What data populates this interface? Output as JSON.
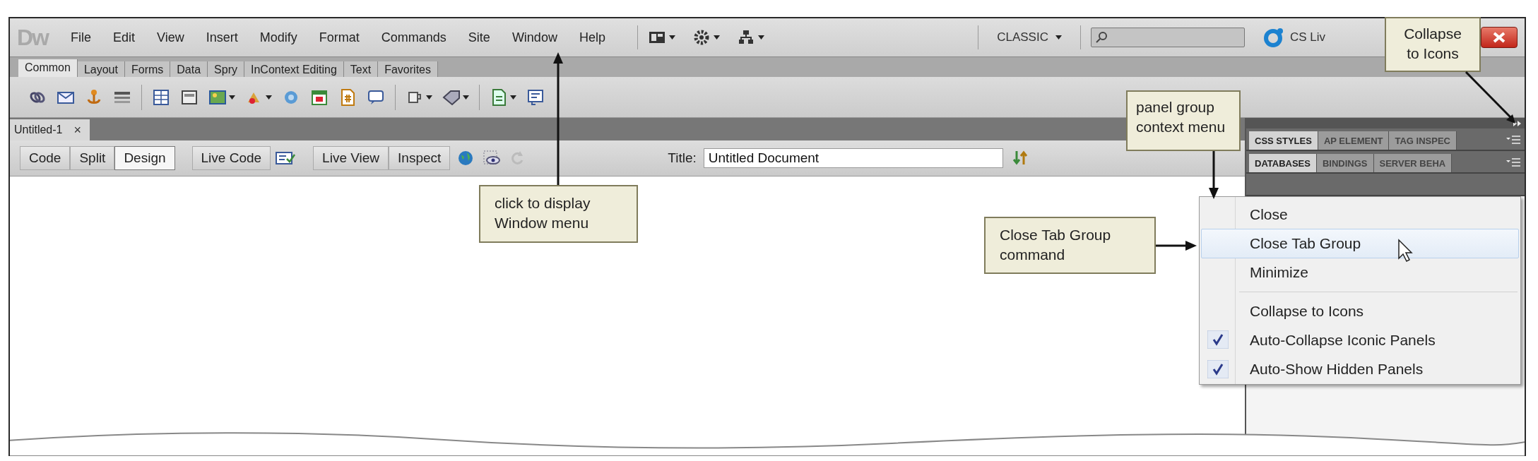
{
  "app": {
    "logo": "Dw",
    "menu": [
      "File",
      "Edit",
      "View",
      "Insert",
      "Modify",
      "Format",
      "Commands",
      "Site",
      "Window",
      "Help"
    ],
    "workspace": "CLASSIC",
    "cs_live": "CS Liv"
  },
  "insert_tabs": [
    {
      "label": "Common",
      "selected": true
    },
    {
      "label": "Layout",
      "selected": false
    },
    {
      "label": "Forms",
      "selected": false
    },
    {
      "label": "Data",
      "selected": false
    },
    {
      "label": "Spry",
      "selected": false
    },
    {
      "label": "InContext Editing",
      "selected": false
    },
    {
      "label": "Text",
      "selected": false
    },
    {
      "label": "Favorites",
      "selected": false
    }
  ],
  "document_tab": {
    "label": "Untitled-1",
    "close": "×"
  },
  "view_buttons": [
    {
      "label": "Code",
      "selected": false
    },
    {
      "label": "Split",
      "selected": false
    },
    {
      "label": "Design",
      "selected": true
    }
  ],
  "live_buttons": [
    "Live Code",
    "Live View",
    "Inspect"
  ],
  "title_field": {
    "label": "Title:",
    "value": "Untitled Document"
  },
  "panel_groups": [
    {
      "tabs": [
        {
          "label": "CSS STYLES",
          "selected": true
        },
        {
          "label": "AP ELEMENT",
          "selected": false
        },
        {
          "label": "TAG INSPEC",
          "selected": false
        }
      ]
    },
    {
      "tabs": [
        {
          "label": "DATABASES",
          "selected": true
        },
        {
          "label": "BINDINGS",
          "selected": false
        },
        {
          "label": "SERVER BEHA",
          "selected": false
        }
      ]
    }
  ],
  "context_menu": [
    {
      "kind": "item",
      "label": "Close",
      "selected": false,
      "checked": false
    },
    {
      "kind": "item",
      "label": "Close Tab Group",
      "selected": true,
      "checked": false
    },
    {
      "kind": "item",
      "label": "Minimize",
      "selected": false,
      "checked": false
    },
    {
      "kind": "separator"
    },
    {
      "kind": "item",
      "label": "Collapse to Icons",
      "selected": false,
      "checked": false
    },
    {
      "kind": "item",
      "label": "Auto-Collapse Iconic Panels",
      "selected": false,
      "checked": true
    },
    {
      "kind": "item",
      "label": "Auto-Show Hidden Panels",
      "selected": false,
      "checked": true
    }
  ],
  "callouts": [
    {
      "text": "click to display\nWindow menu"
    },
    {
      "text": "Collapse\nto Icons"
    },
    {
      "text": "panel group\ncontext menu"
    },
    {
      "text": "Close Tab Group\ncommand"
    }
  ]
}
